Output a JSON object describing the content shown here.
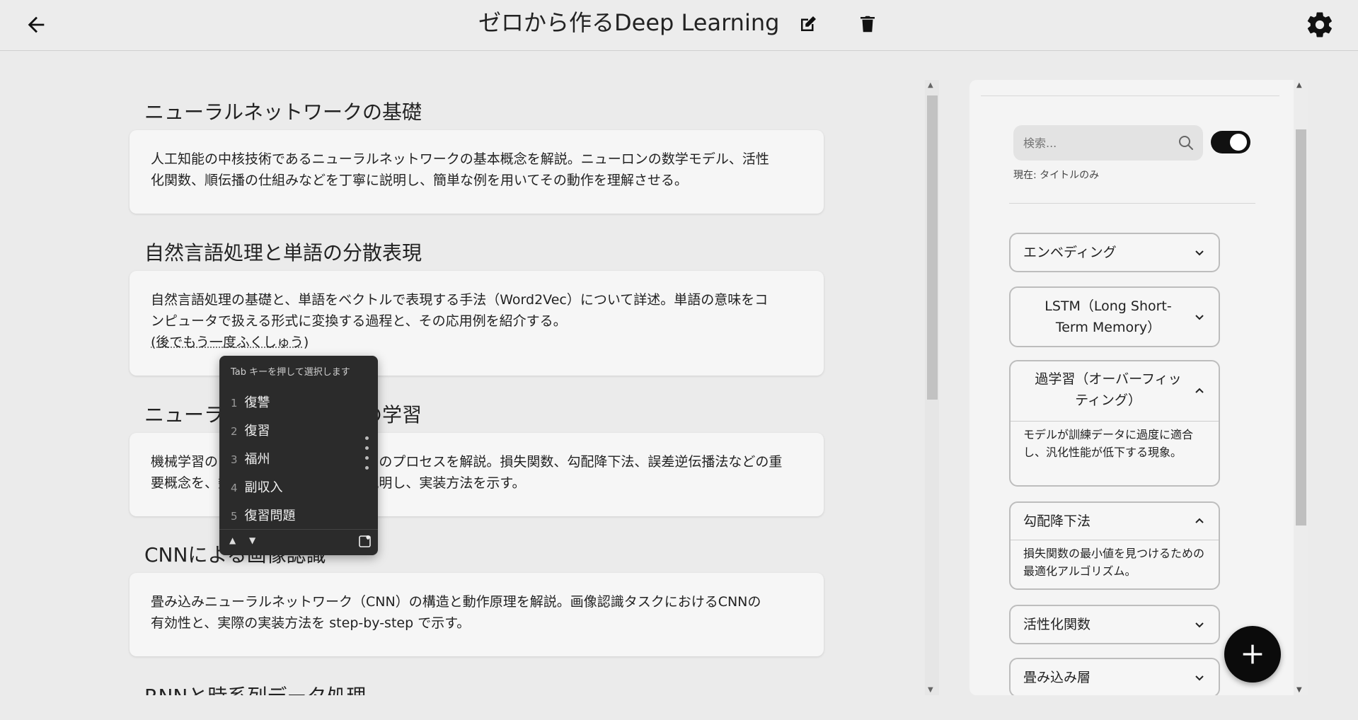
{
  "header": {
    "title": "ゼロから作るDeep Learning",
    "back_icon": "arrow-left-icon",
    "edit_icon": "edit-icon",
    "delete_icon": "trash-icon",
    "settings_icon": "gear-icon"
  },
  "sections": [
    {
      "title": "ニューラルネットワークの基礎",
      "body_lines": [
        "人工知能の中核技術であるニューラルネットワークの基本概念を解説。ニューロンの数学モデル、活性",
        "化関数、順伝播の仕組みなどを丁寧に説明し、簡単な例を用いてその動作を理解させる。"
      ]
    },
    {
      "title": "自然言語処理と単語の分散表現",
      "body_lines": [
        "自然言語処理の基礎と、単語をベクトルで表現する手法（Word2Vec）について詳述。単語の意味をコ",
        "ンピュータで扱える形式に変換する過程と、その応用例を紹介する。",
        "(後でもう一度ふくしゅう)"
      ]
    },
    {
      "title": "ニューラルネットワークの学習",
      "body_lines": [
        "機械学習のアルゴリズムにおける学習のプロセスを解説。損失関数、勾配降下法、誤差逆伝播法などの重",
        "要概念を、数式と図を用いて詳しく説明し、実装方法を示す。"
      ]
    },
    {
      "title": "CNNによる画像認識",
      "body_lines": [
        "畳み込みニューラルネットワーク（CNN）の構造と動作原理を解説。画像認識タスクにおけるCNNの",
        "有効性と、実際の実装方法を step-by-step で示す。"
      ]
    },
    {
      "title": "RNNと時系列データ処理"
    }
  ],
  "ime": {
    "hint": "Tab キーを押して選択します",
    "candidates": [
      {
        "num": "1",
        "text": "復讐"
      },
      {
        "num": "2",
        "text": "復習"
      },
      {
        "num": "3",
        "text": "福州"
      },
      {
        "num": "4",
        "text": "副収入"
      },
      {
        "num": "5",
        "text": "復習問題"
      }
    ],
    "up_icon": "triangle-up-icon",
    "down_icon": "triangle-down-icon",
    "fav_icon": "heart-note-icon"
  },
  "sidebar": {
    "search_placeholder": "検索...",
    "search_icon": "search-icon",
    "toggle_on": true,
    "mode_label": "現在: タイトルのみ",
    "glossary": [
      {
        "title": "エンベディング",
        "expanded": false
      },
      {
        "title_lines": [
          "LSTM（Long Short-",
          "Term Memory）"
        ],
        "expanded": false
      },
      {
        "title_lines": [
          "過学習（オーバーフィッ",
          "ティング）"
        ],
        "expanded": true,
        "definition": "モデルが訓練データに過度に適合し、汎化性能が低下する現象。"
      },
      {
        "title": "勾配降下法",
        "expanded": true,
        "definition": "損失関数の最小値を見つけるための最適化アルゴリズム。"
      },
      {
        "title": "活性化関数",
        "expanded": false
      },
      {
        "title": "畳み込み層",
        "expanded": false
      }
    ]
  },
  "fab": {
    "icon": "plus-icon"
  }
}
